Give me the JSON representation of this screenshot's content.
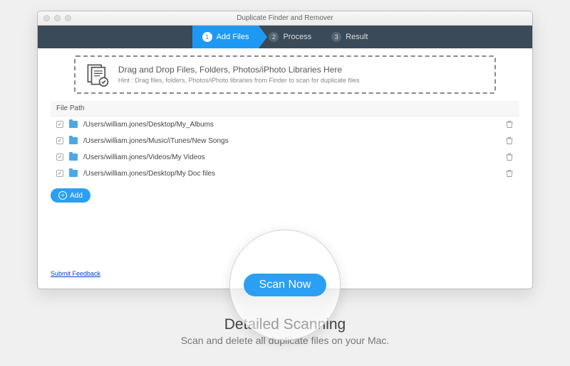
{
  "window_title": "Duplicate Finder and Remover",
  "steps": [
    {
      "num": "1",
      "label": "Add Files"
    },
    {
      "num": "2",
      "label": "Process"
    },
    {
      "num": "3",
      "label": "Result"
    }
  ],
  "dropzone": {
    "title": "Drag and Drop Files, Folders, Photos/iPhoto Libraries Here",
    "hint": "Hint : Drag files, folders, Photos/iPhoto libraries from Finder to scan for duplicate files"
  },
  "table": {
    "header": "File Path",
    "rows": [
      {
        "path": "/Users/william.jones/Desktop/My_Albums"
      },
      {
        "path": "/Users/william.jones/Music/iTunes/New Songs"
      },
      {
        "path": "/Users/william.jones/Videos/My Videos"
      },
      {
        "path": "/Users/william.jones/Desktop/My Doc files"
      }
    ]
  },
  "add_label": "Add",
  "feedback_label": "Submit Feedback",
  "scan_label": "Scan Now",
  "promo": {
    "title": "Detailed Scanning",
    "subtitle": "Scan and delete all duplicate files on your Mac."
  }
}
